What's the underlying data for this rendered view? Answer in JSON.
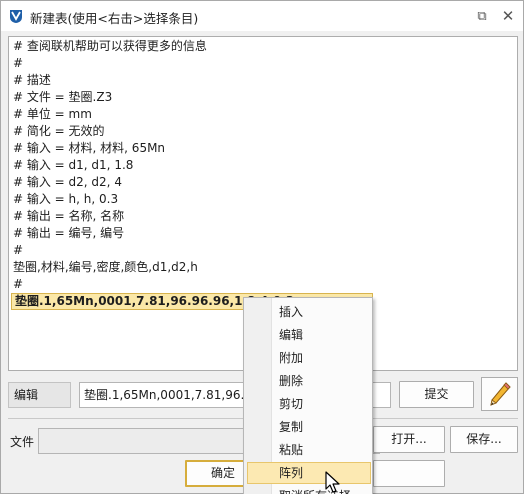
{
  "window": {
    "title": "新建表(使用<右击>选择条目)"
  },
  "titlebar_buttons": {
    "restore": "⧉",
    "close": "✕"
  },
  "editor": {
    "lines": [
      "# 查阅联机帮助可以获得更多的信息",
      "#",
      "# 描述",
      "# 文件 = 垫圈.Z3",
      "# 单位 = mm",
      "# 简化 = 无效的",
      "# 输入 = 材料, 材料, 65Mn",
      "# 输入 = d1, d1, 1.8",
      "# 输入 = d2, d2, 4",
      "# 输入 = h, h, 0.3",
      "# 输出 = 名称, 名称",
      "# 输出 = 编号, 编号",
      "#",
      "垫圈,材料,编号,密度,颜色,d1,d2,h",
      "#"
    ],
    "selected_line": "垫圈.1,65Mn,0001,7.81,96.96.96,1.8,4,0.3"
  },
  "edit_row": {
    "label": "编辑",
    "value": "垫圈.1,65Mn,0001,7.81,96.96",
    "submit_label": "提交"
  },
  "file_row": {
    "label": "文件",
    "value": "",
    "open_label": "打开...",
    "save_label": "保存..."
  },
  "bottom": {
    "ok_label": "确定",
    "cancel_label": "取消"
  },
  "context_menu": {
    "items": [
      "插入",
      "编辑",
      "附加",
      "删除",
      "剪切",
      "复制",
      "粘贴",
      "阵列",
      "取消所有选择"
    ],
    "hovered_index": 7
  },
  "icons": {
    "app": "app-logo-icon",
    "pencil": "pencil-icon",
    "cursor": "mouse-pointer-icon"
  },
  "colors": {
    "selection_bg": "#fbe8a8",
    "menu_hover_bg": "#fce9b2",
    "default_button_border": "#d6ad3c"
  }
}
